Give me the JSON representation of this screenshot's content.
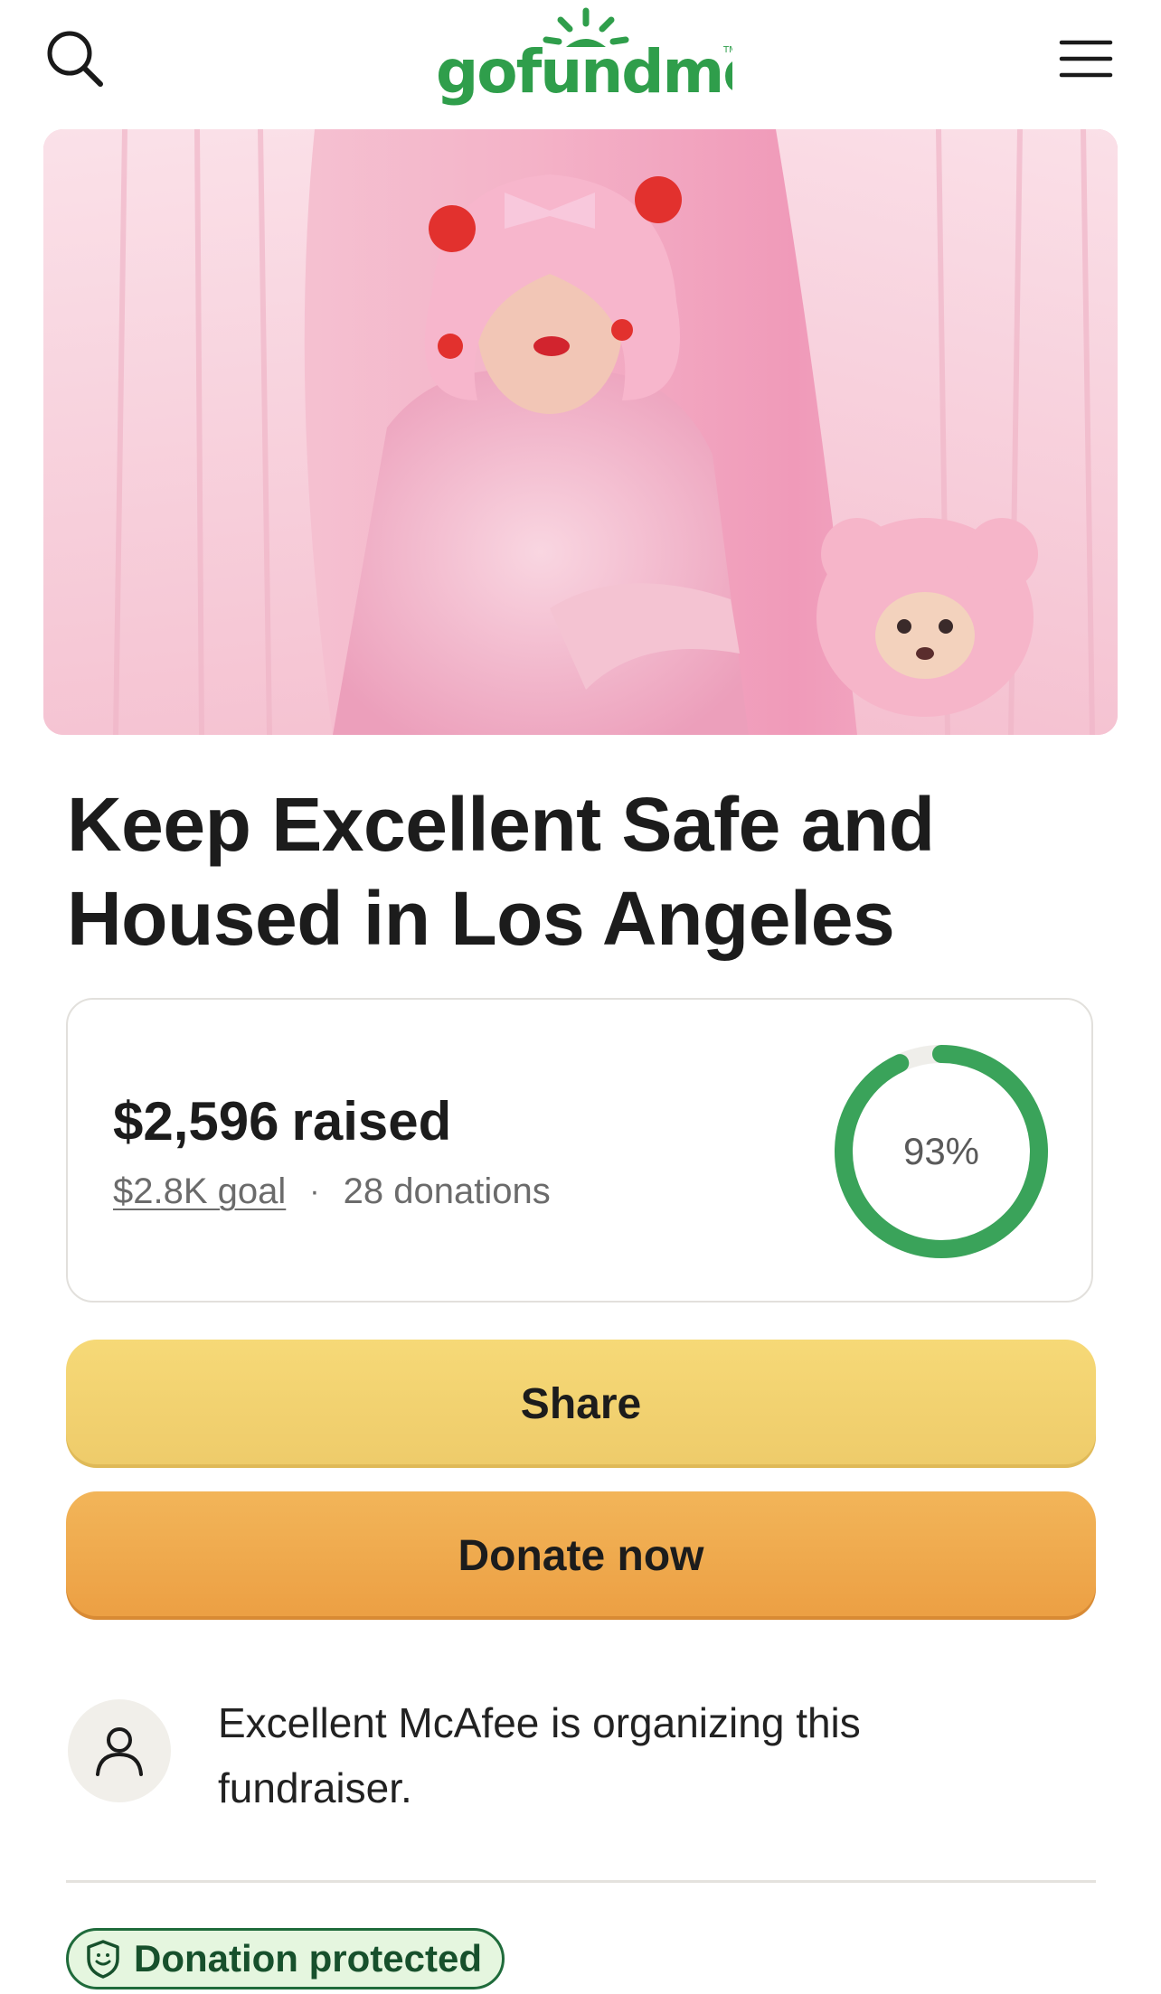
{
  "header": {
    "logo_text": "gofundme",
    "search_icon": "search-icon",
    "menu_icon": "hamburger-menu-icon"
  },
  "hero": {
    "image_alt": "hero-photo"
  },
  "campaign": {
    "title": "Keep Excellent Safe and Housed in Los Angeles"
  },
  "progress": {
    "raised_amount": "$2,596",
    "raised_word": "raised",
    "goal_text": "$2.8K goal",
    "separator": "·",
    "donations_text": "28 donations",
    "percent_label": "93%",
    "percent_value": 0.93,
    "ring_color": "#3aa35a",
    "ring_track_color": "#efeeea"
  },
  "actions": {
    "share_label": "Share",
    "donate_label": "Donate now"
  },
  "organizer": {
    "icon": "user-icon",
    "text": "Excellent McAfee is organizing this fundraiser."
  },
  "badge": {
    "icon": "shield-icon",
    "label": "Donation protected"
  },
  "colors": {
    "brand_green": "#2f9e4b",
    "share_yellow": "#f2d16f",
    "donate_orange": "#ee a64b"
  }
}
